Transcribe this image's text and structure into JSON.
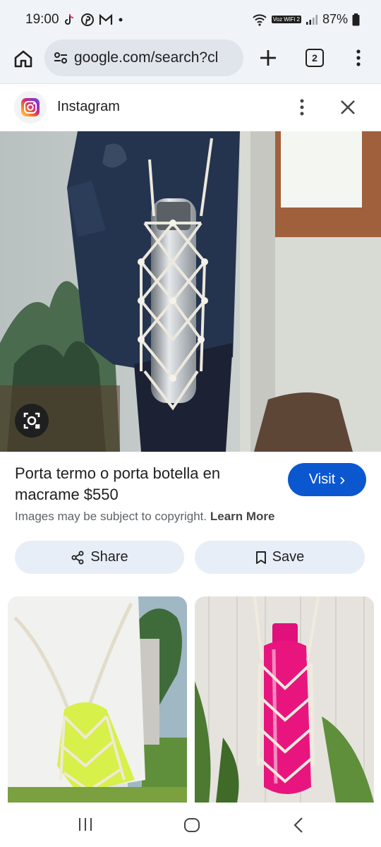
{
  "status_bar": {
    "time": "19:00",
    "notification_icons": [
      "tiktok-icon",
      "pinterest-icon",
      "gmail-icon",
      "dot-icon"
    ],
    "network_label": "Voz WiFi 2",
    "battery": "87%"
  },
  "toolbar": {
    "url": "google.com/search?cl",
    "tab_count": "2"
  },
  "source": {
    "name": "Instagram"
  },
  "result": {
    "title": "Porta termo o porta botella en macrame $550",
    "visit_label": "Visit",
    "visit_chevron": "›",
    "copyright_text": "Images may be subject to copyright.",
    "learn_more": "Learn More"
  },
  "actions": {
    "share_label": "Share",
    "save_label": "Save"
  },
  "colors": {
    "accent": "#0b57d0",
    "chrome_bg": "#f0f4f9",
    "pill_bg": "#e8eef7"
  }
}
